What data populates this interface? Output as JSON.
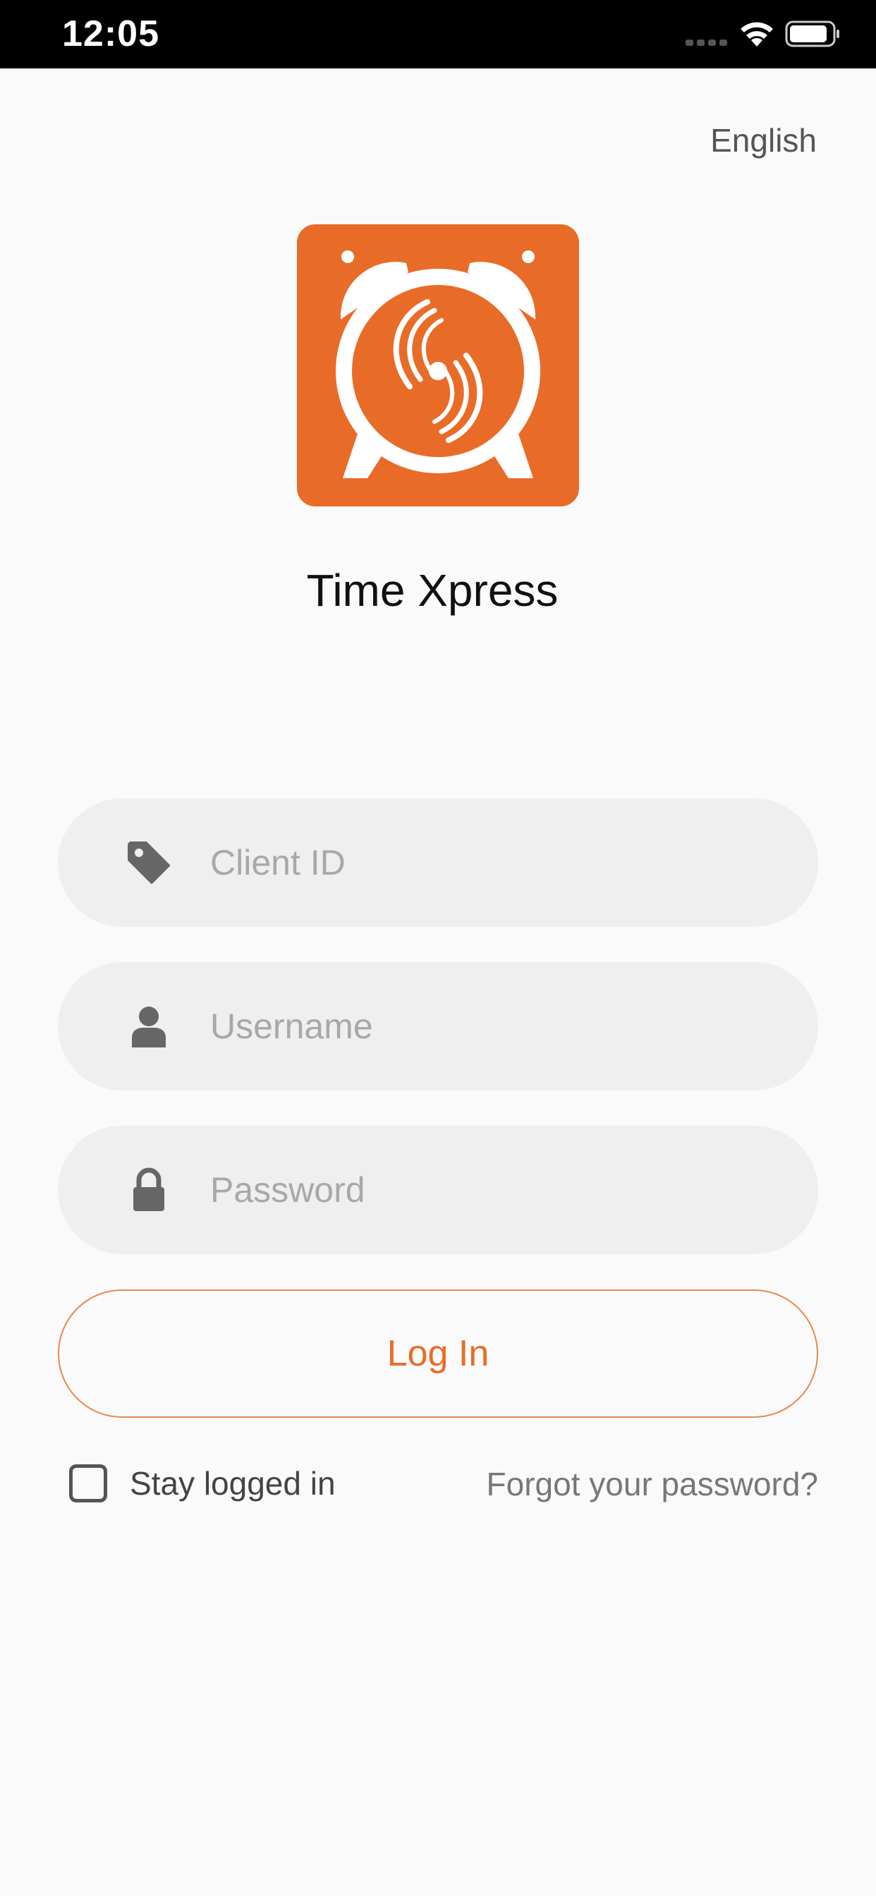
{
  "status_bar": {
    "time": "12:05",
    "icons": [
      "signal-icon",
      "wifi-icon",
      "battery-icon"
    ]
  },
  "header": {
    "language": "English"
  },
  "app": {
    "logo_icon": "alarm-clock-logo-icon",
    "title": "Time Xpress",
    "brand_color": "#e86c28"
  },
  "form": {
    "client_id": {
      "placeholder": "Client ID",
      "value": "",
      "icon": "tag-icon"
    },
    "username": {
      "placeholder": "Username",
      "value": "",
      "icon": "user-icon"
    },
    "password": {
      "placeholder": "Password",
      "value": "",
      "icon": "lock-icon"
    },
    "login_label": "Log In",
    "stay_logged_in_label": "Stay logged in",
    "stay_logged_in_checked": false,
    "forgot_password_label": "Forgot your password?"
  }
}
